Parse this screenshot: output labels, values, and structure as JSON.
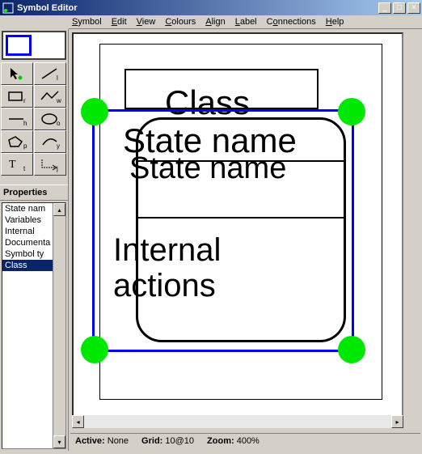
{
  "window": {
    "title": "Symbol Editor"
  },
  "menu": {
    "symbol": "Symbol",
    "edit": "Edit",
    "view": "View",
    "colours": "Colours",
    "align": "Align",
    "label": "Label",
    "connections": "Connections",
    "help": "Help"
  },
  "properties": {
    "header": "Properties",
    "items": [
      "State name",
      "Variables",
      "Internal actions",
      "Documentation",
      "Symbol type",
      "Class"
    ],
    "selected_index": 5
  },
  "canvas": {
    "text_class": "Class",
    "text_state1": "State name",
    "text_state2": "State name",
    "text_internal": "Internal\nactions"
  },
  "status": {
    "active_label": "Active:",
    "active_value": "None",
    "grid_label": "Grid:",
    "grid_value": "10@10",
    "zoom_label": "Zoom:",
    "zoom_value": "400%"
  }
}
